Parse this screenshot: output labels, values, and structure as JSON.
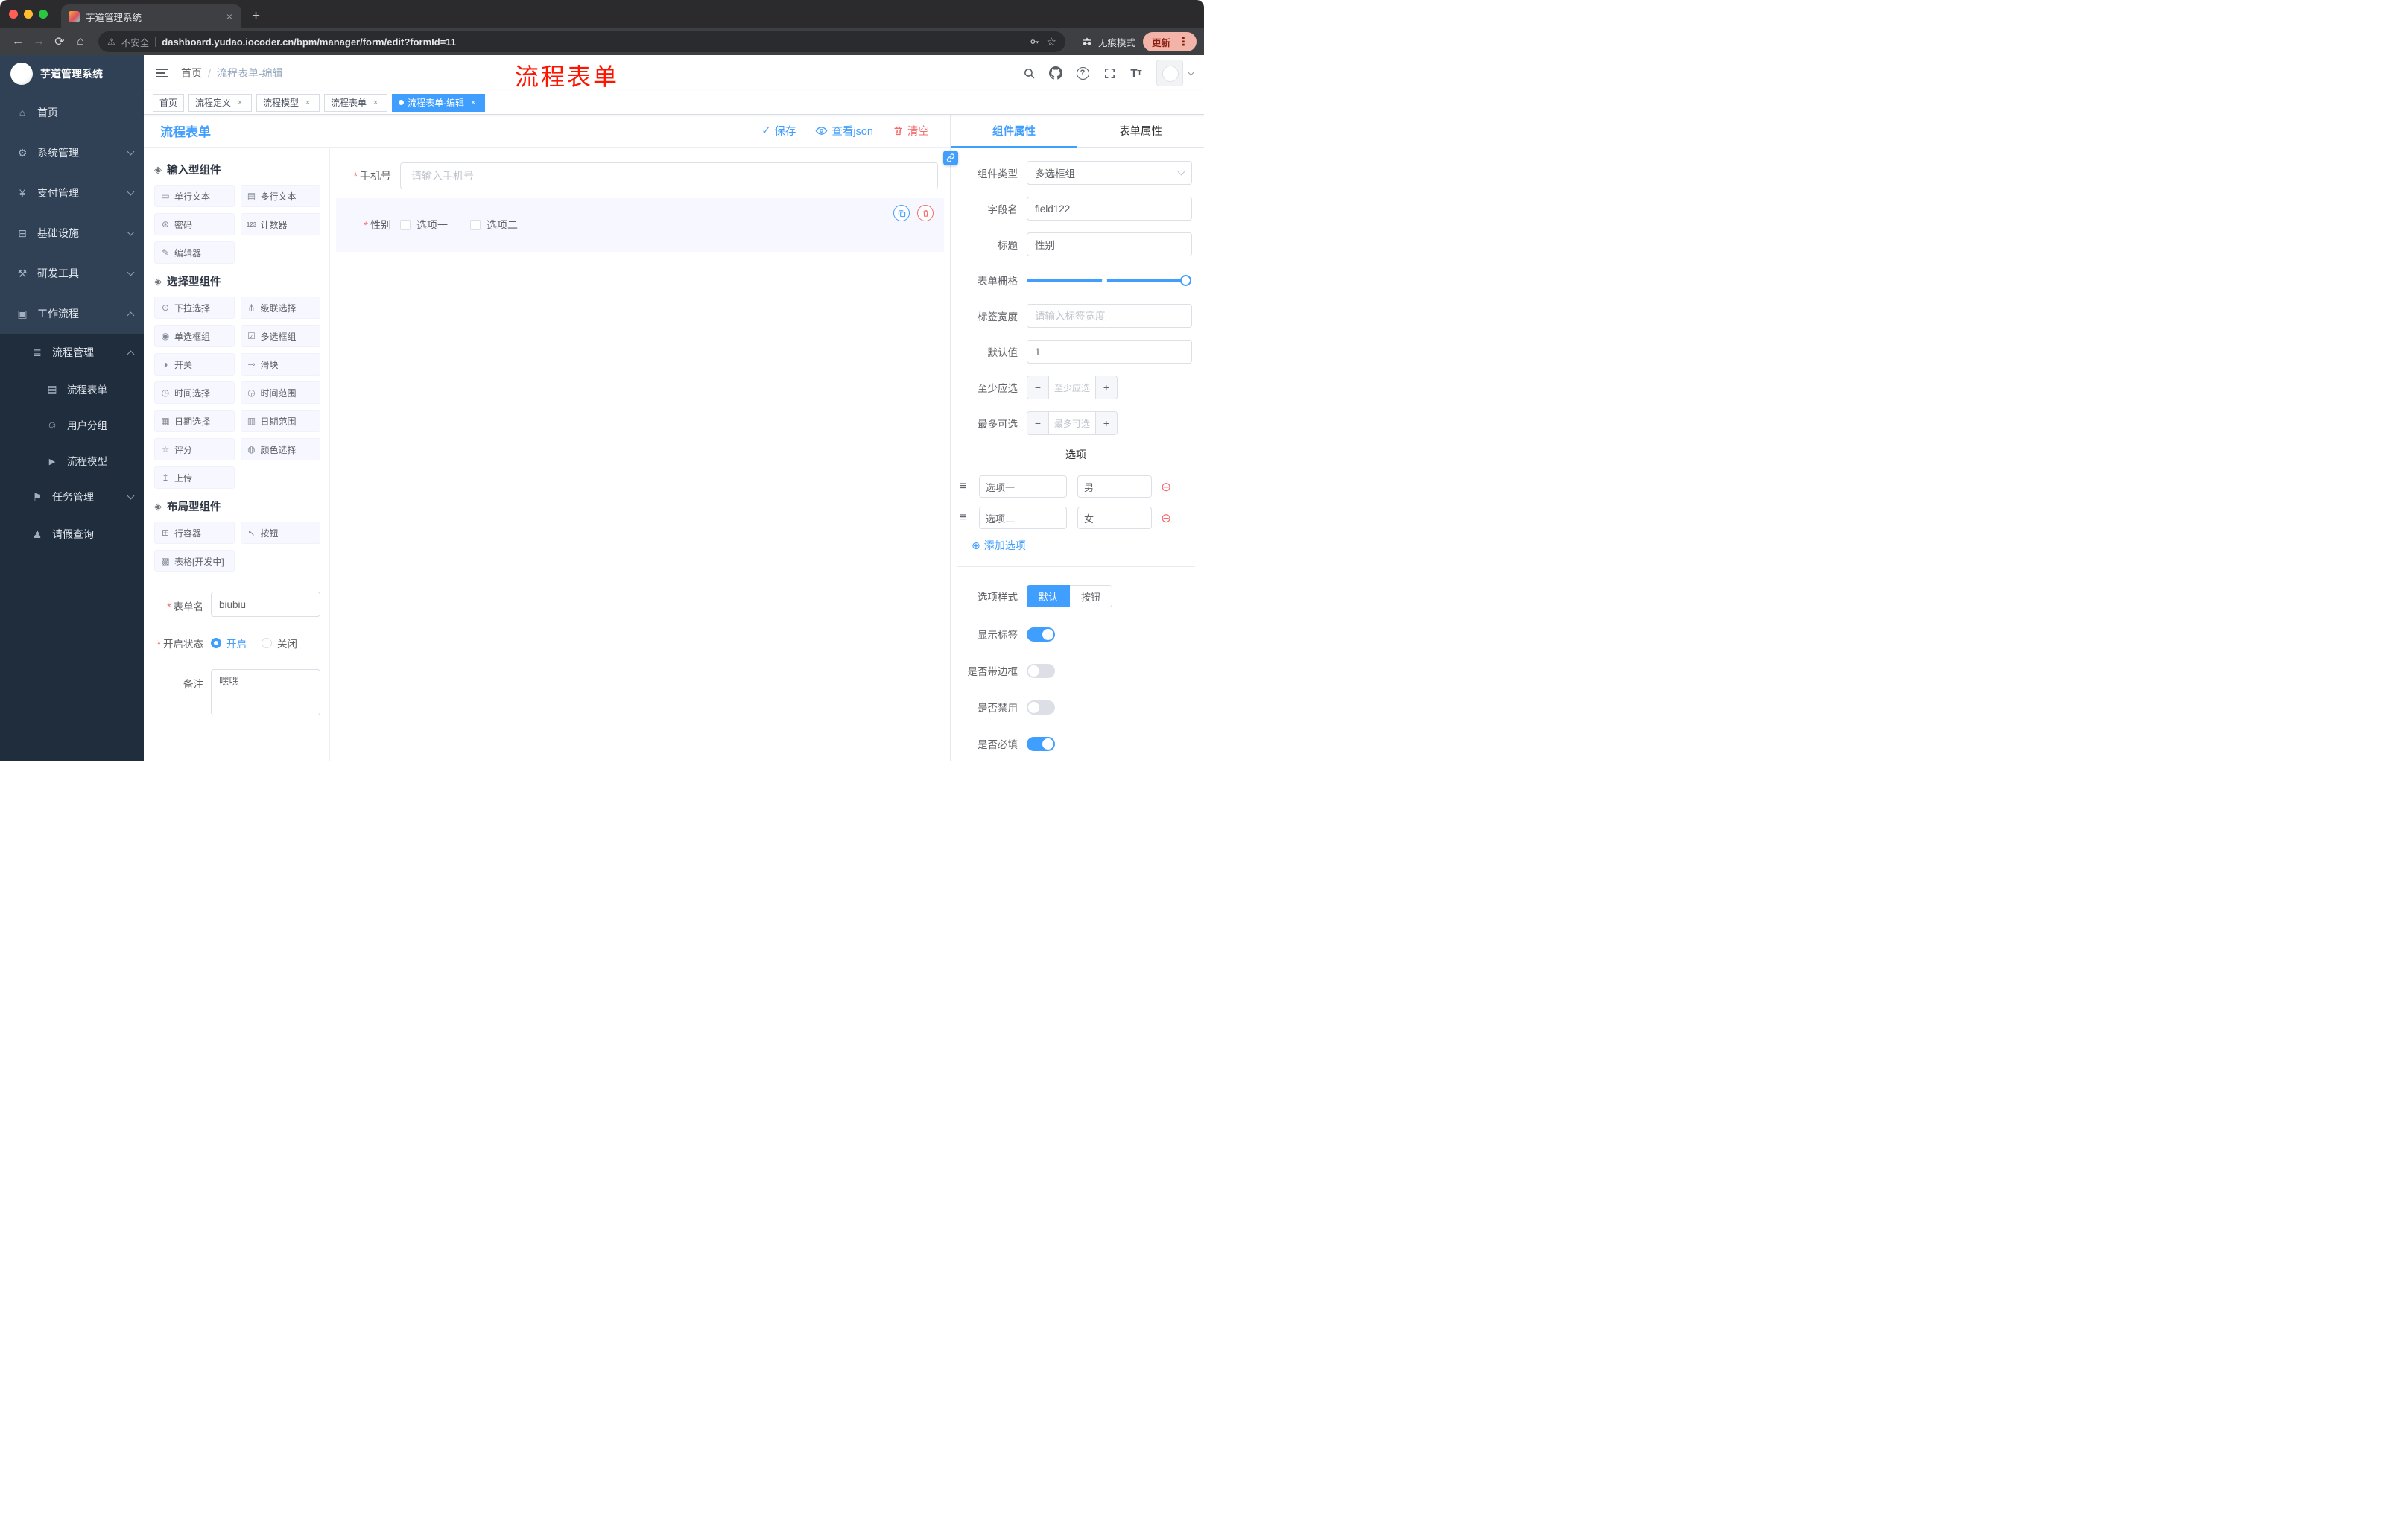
{
  "colors": {
    "accent": "#409eff",
    "danger": "#f56c6c",
    "annotation": "#fe1400",
    "sidebar_bg": "#304156",
    "submenu_bg": "#1f2d3d"
  },
  "browser": {
    "tab_title": "芋道管理系统",
    "security_label": "不安全",
    "url": "dashboard.yudao.iocoder.cn/bpm/manager/form/edit?formId=11",
    "incognito_label": "无痕模式",
    "update_label": "更新"
  },
  "annotation": "流程表单",
  "sidebar": {
    "logo_text": "芋道管理系统",
    "items": [
      {
        "label": "首页",
        "icon": "home-icon"
      },
      {
        "label": "系统管理",
        "icon": "gear-icon"
      },
      {
        "label": "支付管理",
        "icon": "payment-icon"
      },
      {
        "label": "基础设施",
        "icon": "infrastructure-icon"
      },
      {
        "label": "研发工具",
        "icon": "dev-tools-icon"
      },
      {
        "label": "工作流程",
        "icon": "workflow-icon"
      },
      {
        "label": "流程管理",
        "icon": "process-management-icon"
      },
      {
        "label": "流程表单",
        "icon": "form-icon"
      },
      {
        "label": "用户分组",
        "icon": "user-group-icon"
      },
      {
        "label": "流程模型",
        "icon": "process-model-icon"
      },
      {
        "label": "任务管理",
        "icon": "task-icon"
      },
      {
        "label": "请假查询",
        "icon": "person-icon"
      }
    ]
  },
  "header": {
    "breadcrumb_home": "首页",
    "breadcrumb_current": "流程表单-编辑"
  },
  "tags": [
    {
      "label": "首页"
    },
    {
      "label": "流程定义"
    },
    {
      "label": "流程模型"
    },
    {
      "label": "流程表单"
    },
    {
      "label": "流程表单-编辑"
    }
  ],
  "designer": {
    "title": "流程表单",
    "save": "保存",
    "view_json": "查看json",
    "clear": "清空",
    "groups": [
      {
        "title": "输入型组件",
        "items": [
          "单行文本",
          "多行文本",
          "密码",
          "计数器",
          "编辑器"
        ]
      },
      {
        "title": "选择型组件",
        "items": [
          "下拉选择",
          "级联选择",
          "单选框组",
          "多选框组",
          "开关",
          "滑块",
          "时间选择",
          "时间范围",
          "日期选择",
          "日期范围",
          "评分",
          "颜色选择",
          "上传"
        ]
      },
      {
        "title": "布局型组件",
        "items": [
          "行容器",
          "按钮",
          "表格[开发中]"
        ]
      }
    ],
    "meta": {
      "name_label": "表单名",
      "name_value": "biubiu",
      "status_label": "开启状态",
      "status_on": "开启",
      "status_off": "关闭",
      "remark_label": "备注",
      "remark_value": "嘿嘿"
    }
  },
  "canvas": {
    "phone_label": "手机号",
    "phone_placeholder": "请输入手机号",
    "gender_label": "性别",
    "gender_option1": "选项一",
    "gender_option2": "选项二"
  },
  "props": {
    "tab_component": "组件属性",
    "tab_form": "表单属性",
    "type_label": "组件类型",
    "type_value": "多选框组",
    "field_label": "字段名",
    "field_value": "field122",
    "title_label": "标题",
    "title_value": "性别",
    "grid_label": "表单栅格",
    "labelwidth_label": "标签宽度",
    "labelwidth_placeholder": "请输入标签宽度",
    "default_label": "默认值",
    "default_value": "1",
    "min_label": "至少应选",
    "min_placeholder": "至少应选",
    "max_label": "最多可选",
    "max_placeholder": "最多可选",
    "options_title": "选项",
    "options": [
      {
        "label": "选项一",
        "value": "男"
      },
      {
        "label": "选项二",
        "value": "女"
      }
    ],
    "add_option": "添加选项",
    "style_label": "选项样式",
    "style_default": "默认",
    "style_button": "按钮",
    "switches": [
      {
        "label": "显示标签",
        "on": true
      },
      {
        "label": "是否带边框",
        "on": false
      },
      {
        "label": "是否禁用",
        "on": false
      },
      {
        "label": "是否必填",
        "on": true
      }
    ]
  }
}
